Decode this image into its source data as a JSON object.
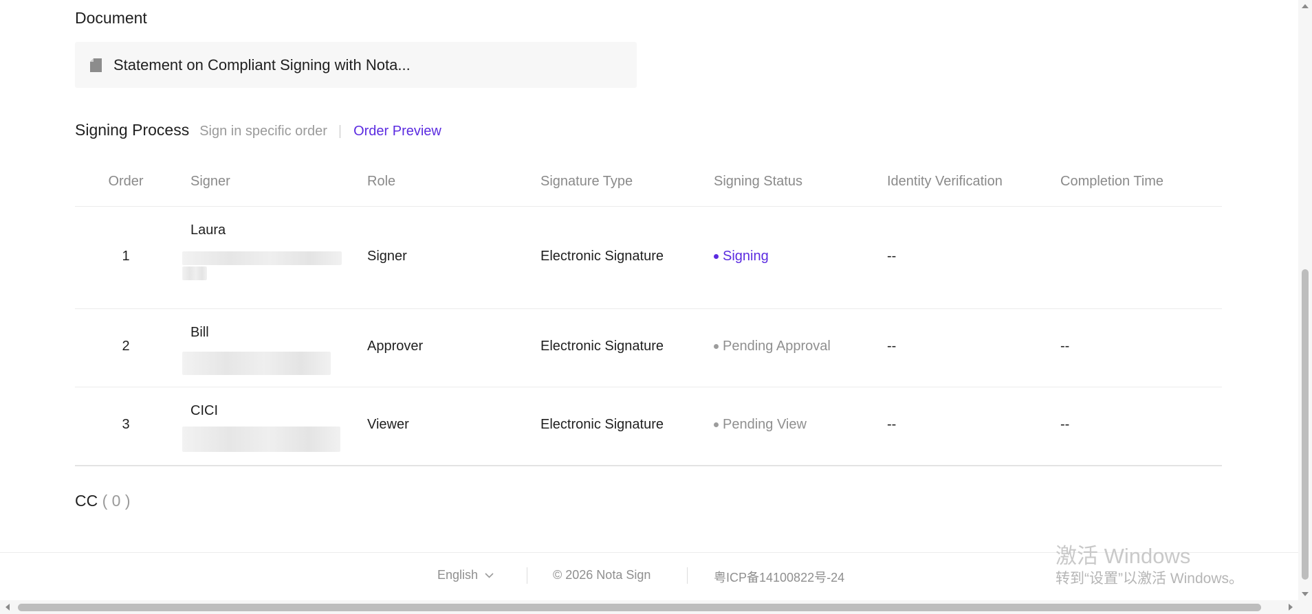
{
  "document": {
    "section_title": "Document",
    "file_name": "Statement on Compliant Signing with Nota..."
  },
  "signing_process": {
    "title": "Signing Process",
    "mode": "Sign in specific order",
    "separator": "|",
    "preview_link": "Order Preview",
    "columns": [
      "Order",
      "Signer",
      "Role",
      "Signature Type",
      "Signing Status",
      "Identity Verification",
      "Completion Time"
    ],
    "rows": [
      {
        "order": "1",
        "signer": "Laura",
        "role": "Signer",
        "signature_type": "Electronic Signature",
        "status": "Signing",
        "identity_verification": "--",
        "completion_time": ""
      },
      {
        "order": "2",
        "signer": "Bill",
        "role": "Approver",
        "signature_type": "Electronic Signature",
        "status": "Pending Approval",
        "identity_verification": "--",
        "completion_time": "--"
      },
      {
        "order": "3",
        "signer": "CICI",
        "role": "Viewer",
        "signature_type": "Electronic Signature",
        "status": "Pending View",
        "identity_verification": "--",
        "completion_time": "--"
      }
    ]
  },
  "cc": {
    "label": "CC",
    "count": "( 0 )"
  },
  "footer": {
    "language": "English",
    "copyright": "© 2026 Nota Sign",
    "icp": "粤ICP备14100822号-24"
  },
  "watermark": {
    "line1": "激活 Windows",
    "line2": "转到“设置”以激活 Windows。"
  },
  "colors": {
    "accent": "#5b2be0",
    "muted": "#8f8f8f",
    "border": "#ebebeb"
  },
  "icons": {
    "document": "document-icon",
    "language_dropdown": "chevron-down-icon"
  }
}
